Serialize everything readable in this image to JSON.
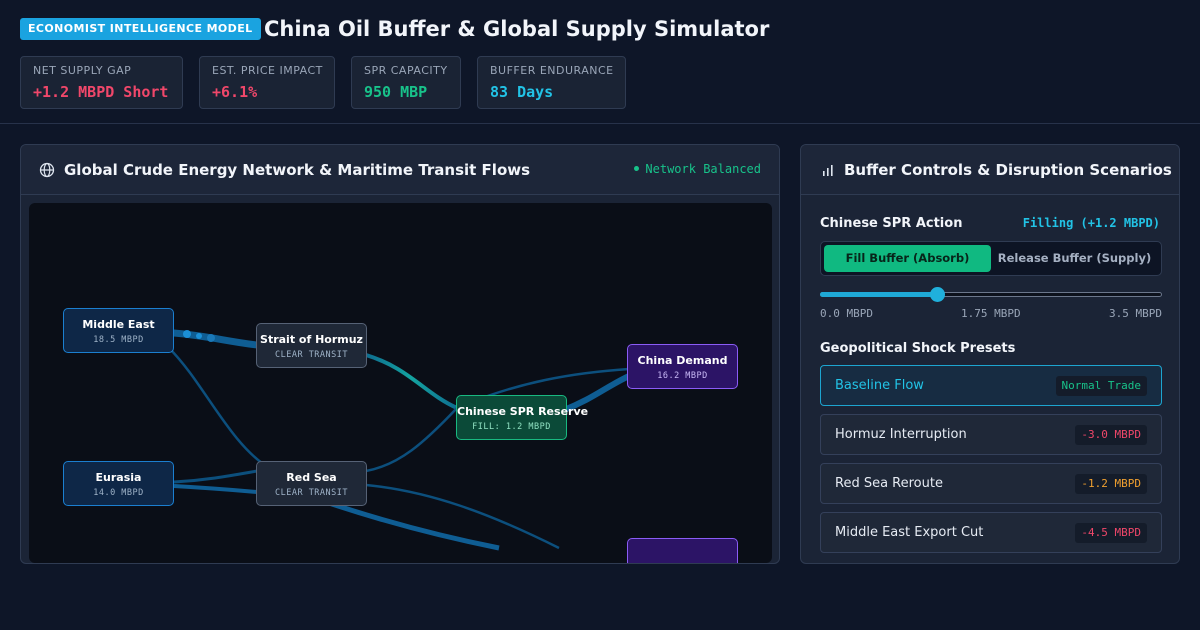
{
  "header": {
    "badge": "ECONOMIST INTELLIGENCE MODEL",
    "title": "China Oil Buffer & Global Supply Simulator",
    "kpis": [
      {
        "label": "NET SUPPLY GAP",
        "value": "+1.2 MBPD Short",
        "color": "#f0476a"
      },
      {
        "label": "EST. PRICE IMPACT",
        "value": "+6.1%",
        "color": "#f0476a"
      },
      {
        "label": "SPR CAPACITY",
        "value": "950 MBP",
        "color": "#18c28a"
      },
      {
        "label": "BUFFER ENDURANCE",
        "value": "83 Days",
        "color": "#22c3e6"
      }
    ]
  },
  "network": {
    "title": "Global Crude Energy Network & Maritime Transit Flows",
    "status": "Network Balanced",
    "nodes": {
      "middle_east": {
        "name": "Middle East",
        "sub": "18.5 MBPD"
      },
      "eurasia": {
        "name": "Eurasia",
        "sub": "14.0 MBPD"
      },
      "hormuz": {
        "name": "Strait of Hormuz",
        "sub": "CLEAR TRANSIT"
      },
      "red_sea": {
        "name": "Red Sea",
        "sub": "CLEAR TRANSIT"
      },
      "spr": {
        "name": "Chinese SPR Reserve",
        "sub": "FILL: 1.2 MBPD"
      },
      "china": {
        "name": "China Demand",
        "sub": "16.2 MBPD"
      }
    }
  },
  "controls": {
    "title": "Buffer Controls & Disruption Scenarios",
    "spr_action_label": "Chinese SPR Action",
    "spr_action_state": "Filling (+1.2 MBPD)",
    "toggle_fill": "Fill Buffer (Absorb)",
    "toggle_release": "Release Buffer (Supply)",
    "slider": {
      "min": 0.0,
      "max": 3.5,
      "value": 1.2,
      "min_label": "0.0 MBPD",
      "mid_label": "1.75 MBPD",
      "max_label": "3.5 MBPD"
    },
    "presets_title": "Geopolitical Shock Presets",
    "presets": [
      {
        "name": "Baseline Flow",
        "tag": "Normal Trade",
        "tag_color": "#18c28a",
        "active": true
      },
      {
        "name": "Hormuz Interruption",
        "tag": "-3.0 MBPD",
        "tag_color": "#f0476a",
        "active": false
      },
      {
        "name": "Red Sea Reroute",
        "tag": "-1.2 MBPD",
        "tag_color": "#f0a030",
        "active": false
      },
      {
        "name": "Middle East Export Cut",
        "tag": "-4.5 MBPD",
        "tag_color": "#f0476a",
        "active": false
      }
    ]
  }
}
